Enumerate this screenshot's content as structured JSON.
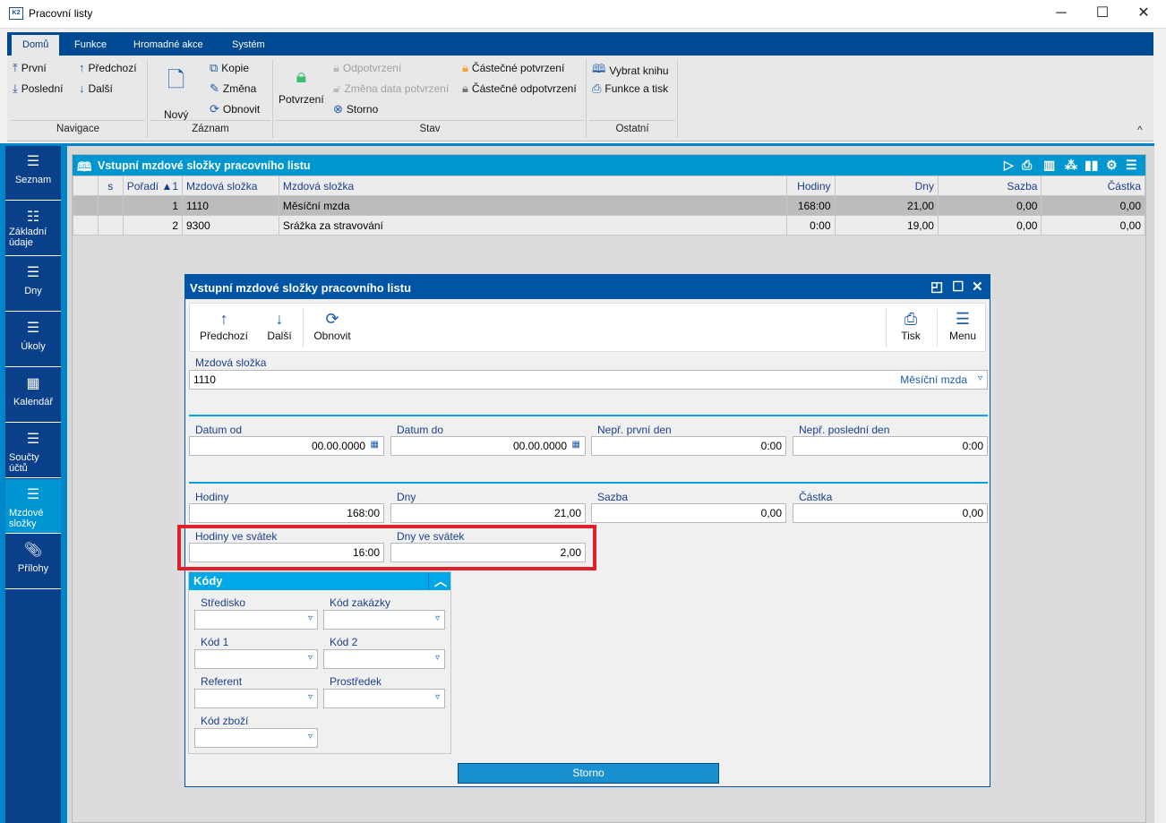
{
  "window": {
    "title": "Pracovní listy",
    "app_icon": "K2",
    "minimize": "─",
    "maximize": "☐",
    "close": "✕"
  },
  "ribbon": {
    "tabs": [
      {
        "label": "Domů",
        "active": true
      },
      {
        "label": "Funkce"
      },
      {
        "label": "Hromadné akce"
      },
      {
        "label": "Systém"
      }
    ],
    "groups": {
      "navigace": "Navigace",
      "zaznam": "Záznam",
      "stav": "Stav",
      "ostatni": "Ostatní"
    },
    "buttons": {
      "prvni": "První",
      "posledni": "Poslední",
      "predchozi": "Předchozí",
      "dalsi": "Další",
      "novy": "Nový",
      "kopie": "Kopie",
      "zmena": "Změna",
      "obnovit": "Obnovit",
      "potvrzeni": "Potvrzení",
      "odpotvrzeni": "Odpotvrzení",
      "zmena_data": "Změna data potvrzení",
      "storno": "Storno",
      "castecne_potvrzeni": "Částečné potvrzení",
      "castecne_odpotvrzeni": "Částečné odpotvrzení",
      "vybrat_knihu": "Vybrat knihu",
      "funkce_tisk": "Funkce a tisk"
    },
    "collapse": "^"
  },
  "sidebar": {
    "items": [
      {
        "label": "Seznam",
        "icon": "list-icon"
      },
      {
        "label": "Základní údaje",
        "icon": "bullet-list-icon"
      },
      {
        "label": "Dny",
        "icon": "list-icon"
      },
      {
        "label": "Úkoly",
        "icon": "list-icon"
      },
      {
        "label": "Kalendář",
        "icon": "calendar-icon"
      },
      {
        "label": "Součty účtů",
        "icon": "list-icon"
      },
      {
        "label": "Mzdové složky",
        "icon": "list-icon",
        "active": true
      },
      {
        "label": "Přílohy",
        "icon": "paperclip-icon"
      }
    ]
  },
  "grid": {
    "title": "Vstupní mzdové složky pracovního listu",
    "columns": [
      "",
      "s",
      "Pořadí ▲1",
      "Mzdová složka",
      "Mzdová složka",
      "Hodiny",
      "Dny",
      "Sazba",
      "Částka"
    ],
    "rows": [
      [
        "",
        "",
        "1",
        "1110",
        "Měsíční mzda",
        "168:00",
        "21,00",
        "0,00",
        "0,00"
      ],
      [
        "",
        "",
        "2",
        "9300",
        "Srážka za stravování",
        "0:00",
        "19,00",
        "0,00",
        "0,00"
      ]
    ]
  },
  "dialog": {
    "title": "Vstupní mzdové složky pracovního listu",
    "toolbar": {
      "predchozi": "Předchozí",
      "dalsi": "Další",
      "obnovit": "Obnovit",
      "tisk": "Tisk",
      "menu": "Menu"
    },
    "mzdova_slozka": {
      "label": "Mzdová složka",
      "code": "1110",
      "name": "Měsíční mzda"
    },
    "datum_od": {
      "label": "Datum od",
      "value": "00.00.0000"
    },
    "datum_do": {
      "label": "Datum do",
      "value": "00.00.0000"
    },
    "nepr_prvni": {
      "label": "Nepř. první den",
      "value": "0:00"
    },
    "nepr_posledni": {
      "label": "Nepř. poslední den",
      "value": "0:00"
    },
    "hodiny": {
      "label": "Hodiny",
      "value": "168:00"
    },
    "dny": {
      "label": "Dny",
      "value": "21,00"
    },
    "sazba": {
      "label": "Sazba",
      "value": "0,00"
    },
    "castka": {
      "label": "Částka",
      "value": "0,00"
    },
    "hodiny_svatek": {
      "label": "Hodiny ve svátek",
      "value": "16:00"
    },
    "dny_svatek": {
      "label": "Dny ve svátek",
      "value": "2,00"
    },
    "kody": {
      "title": "Kódy",
      "fields": [
        "Středisko",
        "Kód zakázky",
        "Kód 1",
        "Kód 2",
        "Referent",
        "Prostředek",
        "Kód zboží"
      ]
    },
    "storno": "Storno"
  },
  "colors": {
    "ribbon_blue": "#004a94",
    "grid_header": "#0096cf",
    "dialog_title": "#0054a6",
    "highlight": "#e0202a"
  }
}
